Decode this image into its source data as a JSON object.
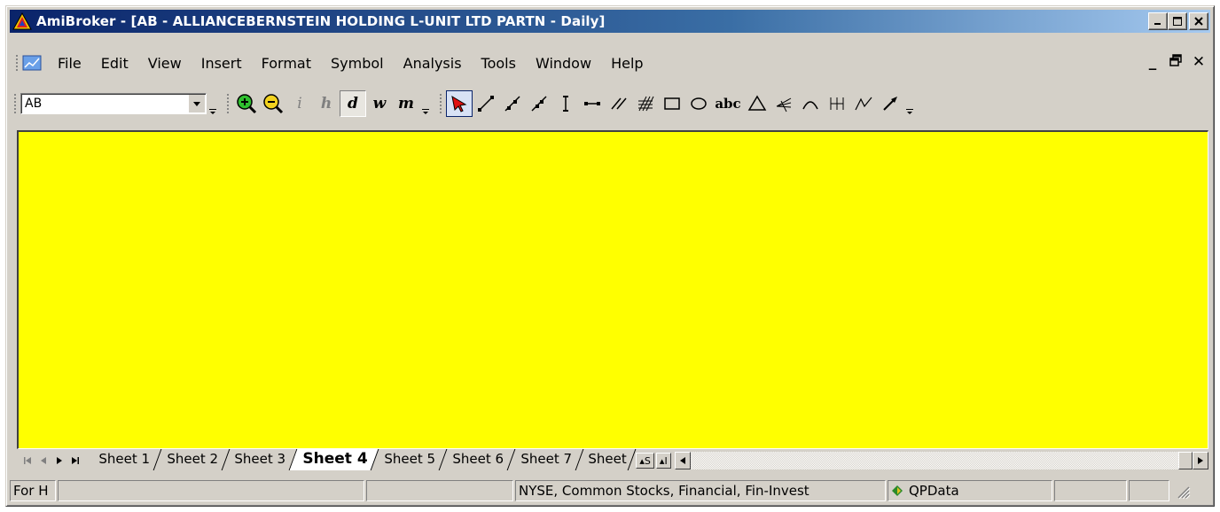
{
  "window": {
    "title": "AmiBroker - [AB - ALLIANCEBERNSTEIN HOLDING L-UNIT LTD PARTN - Daily]"
  },
  "menu": {
    "items": [
      "File",
      "Edit",
      "View",
      "Insert",
      "Format",
      "Symbol",
      "Analysis",
      "Tools",
      "Window",
      "Help"
    ]
  },
  "toolbar": {
    "symbol_value": "AB",
    "interval_buttons": [
      "i",
      "h",
      "d",
      "w",
      "m"
    ],
    "text_tool_label": "abc"
  },
  "chart": {
    "background_color": "#ffff00"
  },
  "sheets": {
    "tabs": [
      "Sheet 1",
      "Sheet 2",
      "Sheet 3",
      "Sheet 4",
      "Sheet 5",
      "Sheet 6",
      "Sheet 7",
      "Sheet"
    ],
    "active_index": 3,
    "scroll_labels": [
      "▴S",
      "▴I"
    ]
  },
  "status": {
    "pane1": "For H",
    "pane2": "",
    "pane3": "",
    "category": "NYSE, Common Stocks, Financial, Fin-Invest",
    "datasource": "QPData",
    "pane6": "",
    "pane7": ""
  }
}
